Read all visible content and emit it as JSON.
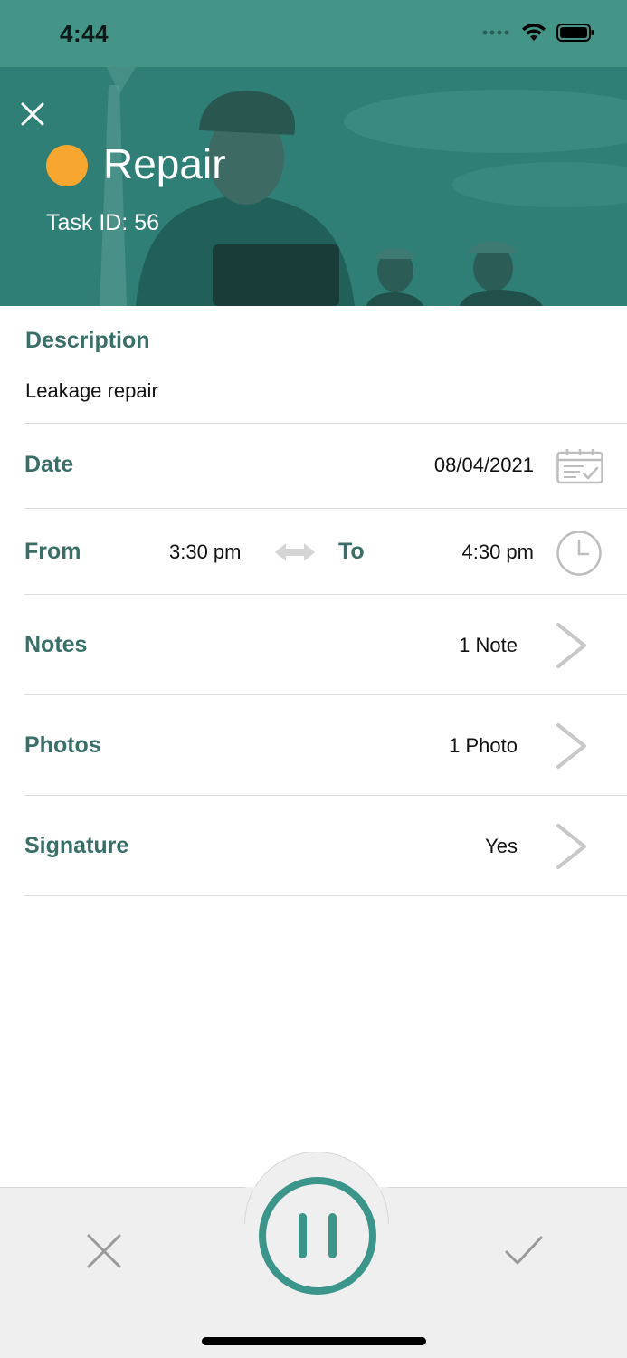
{
  "status_bar": {
    "time": "4:44",
    "icons": [
      "signal-dots-icon",
      "wifi-icon",
      "battery-icon"
    ]
  },
  "header": {
    "close_icon": "close-icon",
    "status_color": "#F7A730",
    "title": "Repair",
    "task_id": "Task ID: 56"
  },
  "description": {
    "label": "Description",
    "text": "Leakage repair"
  },
  "date_row": {
    "label": "Date",
    "value": "08/04/2021",
    "icon": "calendar-check-icon"
  },
  "time_row": {
    "from_label": "From",
    "from_value": "3:30 pm",
    "swap_icon": "swap-arrows-icon",
    "to_label": "To",
    "to_value": "4:30 pm",
    "icon": "clock-icon"
  },
  "notes_row": {
    "label": "Notes",
    "value": "1 Note",
    "icon": "chevron-right-icon"
  },
  "photos_row": {
    "label": "Photos",
    "value": "1 Photo",
    "icon": "chevron-right-icon"
  },
  "signature_row": {
    "label": "Signature",
    "value": "Yes",
    "icon": "chevron-right-icon"
  },
  "bottom_bar": {
    "cancel_icon": "close-icon",
    "pause_icon": "pause-icon",
    "confirm_icon": "checkmark-icon"
  },
  "colors": {
    "accent": "#3b958a",
    "label": "#3a6e68",
    "status_bar": "#449488",
    "status_dot": "#F7A730"
  }
}
